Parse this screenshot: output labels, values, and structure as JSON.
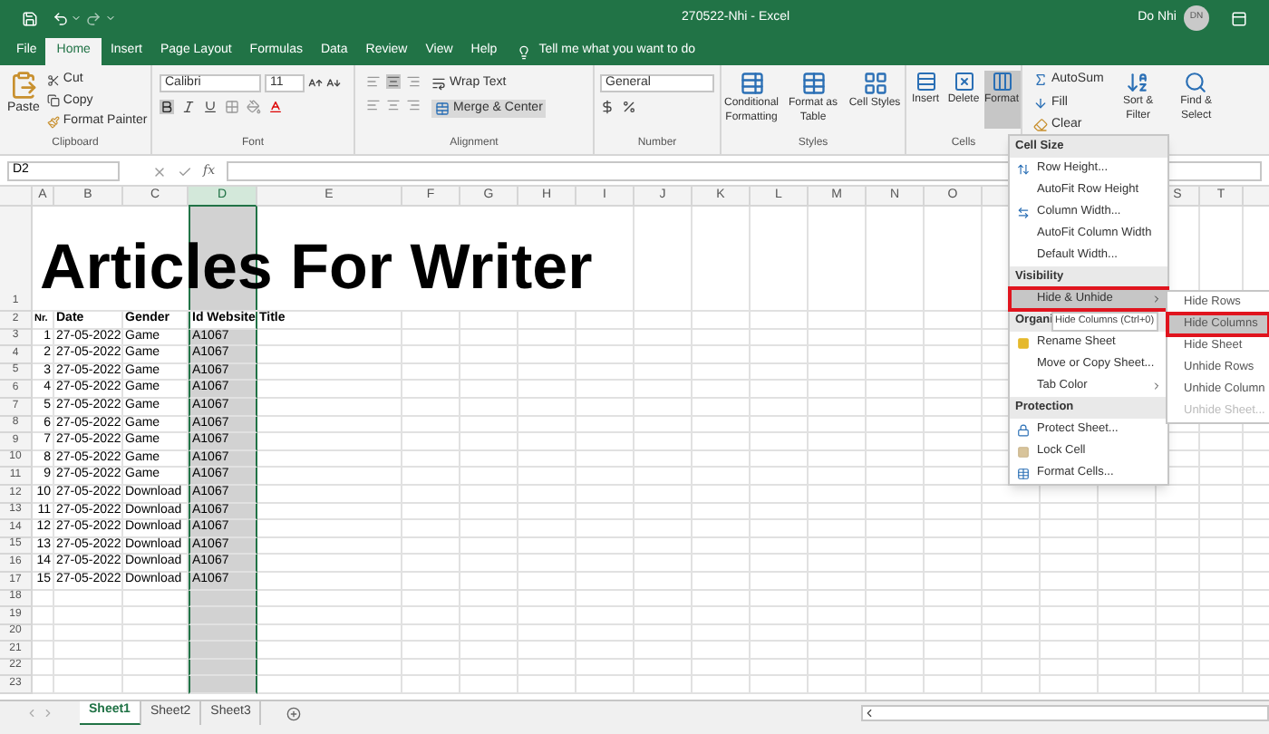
{
  "window": {
    "title": "270522-Nhi - Excel",
    "user": "Do Nhi",
    "avatar": "DN"
  },
  "tabs": [
    {
      "label": "File",
      "selected": false
    },
    {
      "label": "Home",
      "selected": true
    },
    {
      "label": "Insert",
      "selected": false
    },
    {
      "label": "Page Layout",
      "selected": false
    },
    {
      "label": "Formulas",
      "selected": false
    },
    {
      "label": "Data",
      "selected": false
    },
    {
      "label": "Review",
      "selected": false
    },
    {
      "label": "View",
      "selected": false
    },
    {
      "label": "Help",
      "selected": false
    }
  ],
  "tell_me": "Tell me what you want to do",
  "ribbon": {
    "clipboard": {
      "label": "Clipboard",
      "paste": "Paste",
      "cut": "Cut",
      "copy": "Copy",
      "format_painter": "Format Painter"
    },
    "font": {
      "label": "Font",
      "name": "Calibri",
      "size": "11"
    },
    "alignment": {
      "label": "Alignment",
      "wrap": "Wrap Text",
      "merge": "Merge & Center"
    },
    "number": {
      "label": "Number",
      "format": "General"
    },
    "styles": {
      "label": "Styles",
      "buttons": [
        "Conditional Formatting",
        "Format as Table",
        "Cell Styles"
      ]
    },
    "cells": {
      "label": "Cells",
      "buttons": [
        {
          "label": "Insert",
          "pressed": false
        },
        {
          "label": "Delete",
          "pressed": false
        },
        {
          "label": "Format",
          "pressed": true
        }
      ]
    },
    "editing": {
      "small": [
        "AutoSum",
        "Fill",
        "Clear"
      ],
      "big": [
        "Sort & Filter",
        "Find & Select"
      ]
    }
  },
  "formula_bar": {
    "name_box": "D2",
    "function_label": "fx"
  },
  "sheet": {
    "columns": [
      {
        "label": "A",
        "selected": false
      },
      {
        "label": "B",
        "selected": false
      },
      {
        "label": "C",
        "selected": false
      },
      {
        "label": "D",
        "selected": true
      },
      {
        "label": "E",
        "selected": false
      },
      {
        "label": "F",
        "selected": false
      },
      {
        "label": "G",
        "selected": false
      },
      {
        "label": "H",
        "selected": false
      },
      {
        "label": "I",
        "selected": false
      },
      {
        "label": "J",
        "selected": false
      },
      {
        "label": "K",
        "selected": false
      },
      {
        "label": "L",
        "selected": false
      },
      {
        "label": "M",
        "selected": false
      },
      {
        "label": "N",
        "selected": false
      },
      {
        "label": "O",
        "selected": false
      },
      {
        "label": "S",
        "selected": false
      },
      {
        "label": "T",
        "selected": false
      }
    ],
    "row_labels": [
      "1",
      "2",
      "3",
      "4",
      "5",
      "6",
      "7",
      "8",
      "9",
      "10",
      "11",
      "12",
      "13",
      "14",
      "15",
      "16",
      "17",
      "18",
      "19",
      "20",
      "21",
      "22",
      "23"
    ],
    "title": "Articles For Writer",
    "header": [
      "Nr.",
      "Date",
      "Gender",
      "Id Website",
      "Title"
    ],
    "records": [
      [
        "1",
        "27-05-2022",
        "Game",
        "A1067"
      ],
      [
        "2",
        "27-05-2022",
        "Game",
        "A1067"
      ],
      [
        "3",
        "27-05-2022",
        "Game",
        "A1067"
      ],
      [
        "4",
        "27-05-2022",
        "Game",
        "A1067"
      ],
      [
        "5",
        "27-05-2022",
        "Game",
        "A1067"
      ],
      [
        "6",
        "27-05-2022",
        "Game",
        "A1067"
      ],
      [
        "7",
        "27-05-2022",
        "Game",
        "A1067"
      ],
      [
        "8",
        "27-05-2022",
        "Game",
        "A1067"
      ],
      [
        "9",
        "27-05-2022",
        "Game",
        "A1067"
      ],
      [
        "10",
        "27-05-2022",
        "Download",
        "A1067"
      ],
      [
        "11",
        "27-05-2022",
        "Download",
        "A1067"
      ],
      [
        "12",
        "27-05-2022",
        "Download",
        "A1067"
      ],
      [
        "13",
        "27-05-2022",
        "Download",
        "A1067"
      ],
      [
        "14",
        "27-05-2022",
        "Download",
        "A1067"
      ],
      [
        "15",
        "27-05-2022",
        "Download",
        "A1067"
      ]
    ]
  },
  "format_menu": [
    {
      "kind": "heading",
      "label": "Cell Size"
    },
    {
      "kind": "item",
      "label": "Row Height...",
      "selected": false,
      "outlined": false
    },
    {
      "kind": "item",
      "label": "AutoFit Row Height",
      "selected": false,
      "outlined": false
    },
    {
      "kind": "item",
      "label": "Column Width...",
      "selected": false,
      "outlined": false
    },
    {
      "kind": "item",
      "label": "AutoFit Column Width",
      "selected": false,
      "outlined": false
    },
    {
      "kind": "item",
      "label": "Default Width...",
      "selected": false,
      "outlined": false
    },
    {
      "kind": "heading",
      "label": "Visibility"
    },
    {
      "kind": "submenu",
      "label": "Hide & Unhide",
      "selected": true,
      "outlined": true
    },
    {
      "kind": "heading",
      "label": "Organi"
    },
    {
      "kind": "item",
      "label": "Rename Sheet",
      "selected": false,
      "outlined": false
    },
    {
      "kind": "item",
      "label": "Move or Copy Sheet...",
      "selected": false,
      "outlined": false
    },
    {
      "kind": "submenu",
      "label": "Tab Color",
      "selected": false,
      "outlined": false
    },
    {
      "kind": "heading",
      "label": "Protection"
    },
    {
      "kind": "item",
      "label": "Protect Sheet...",
      "selected": false,
      "outlined": false
    },
    {
      "kind": "item",
      "label": "Lock Cell",
      "selected": false,
      "outlined": false
    },
    {
      "kind": "item",
      "label": "Format Cells...",
      "selected": false,
      "outlined": false
    }
  ],
  "tooltip": "Hide Columns (Ctrl+0)",
  "hide_submenu": [
    {
      "label": "Hide Rows",
      "selected": false,
      "outlined": false,
      "disabled": false
    },
    {
      "label": "Hide Columns",
      "selected": true,
      "outlined": true,
      "disabled": false
    },
    {
      "label": "Hide Sheet",
      "selected": false,
      "outlined": false,
      "disabled": false
    },
    {
      "label": "Unhide Rows",
      "selected": false,
      "outlined": false,
      "disabled": false
    },
    {
      "label": "Unhide Column",
      "selected": false,
      "outlined": false,
      "disabled": false
    },
    {
      "label": "Unhide Sheet...",
      "selected": false,
      "outlined": false,
      "disabled": true
    }
  ],
  "sheet_tabs": [
    {
      "label": "Sheet1",
      "selected": true
    },
    {
      "label": "Sheet2",
      "selected": false
    },
    {
      "label": "Sheet3",
      "selected": false
    }
  ]
}
